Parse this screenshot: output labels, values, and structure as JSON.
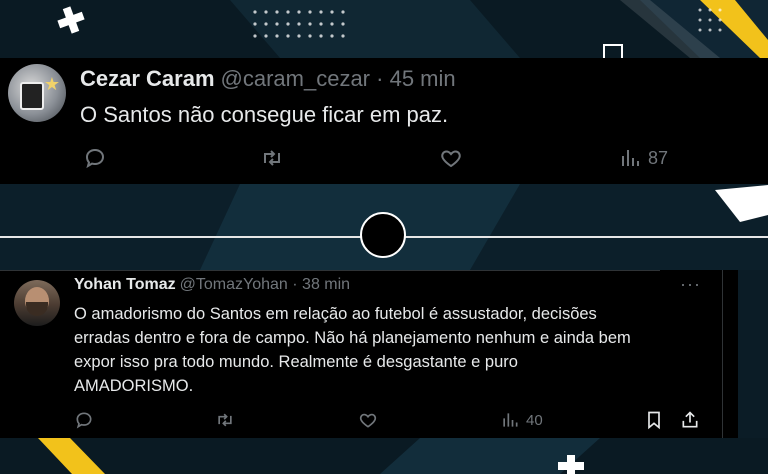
{
  "tweets": [
    {
      "display_name": "Cezar Caram",
      "handle": "@caram_cezar",
      "separator": "·",
      "time": "45 min",
      "text": "O Santos não consegue ficar em paz.",
      "views": "87",
      "icons": [
        "reply-icon",
        "retweet-icon",
        "like-icon",
        "views-icon"
      ]
    },
    {
      "display_name": "Yohan Tomaz",
      "handle": "@TomazYohan",
      "separator": "·",
      "time": "38 min",
      "more": "···",
      "text": "O amadorismo do Santos em relação ao futebol é assustador, decisões\nerradas dentro e fora de campo. Não há planejamento nenhum e ainda bem\nexpor isso pra todo mundo. Realmente é desgastante e puro\nAMADORISMO.",
      "views": "40",
      "icons": [
        "reply-icon",
        "retweet-icon",
        "like-icon",
        "views-icon",
        "bookmark-icon",
        "share-icon"
      ]
    }
  ],
  "colors": {
    "background_dark": "#0a1a24",
    "card": "#000000",
    "accent_yellow": "#f2c21b",
    "text_primary": "#e7e9ea",
    "text_secondary": "#71767b"
  }
}
